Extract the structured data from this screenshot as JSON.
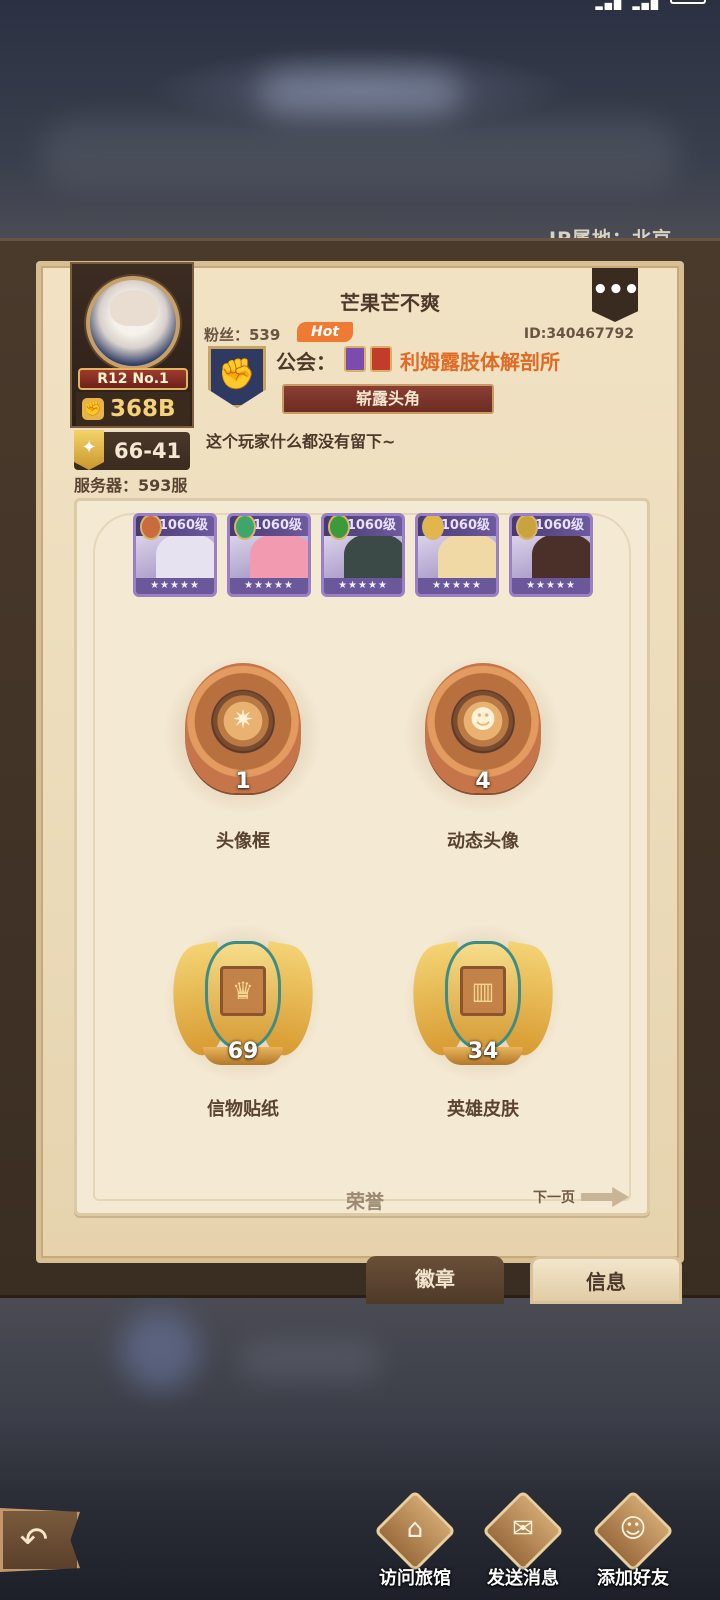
{
  "ip_location": "IP属地：北京",
  "profile": {
    "name": "芒果芒不爽",
    "fans": "粉丝：539",
    "hot_badge": "Hot",
    "id": "ID:340467792",
    "rank": "R12 No.1",
    "power": "368B",
    "score": "66-41",
    "server": "服务器：593服",
    "signature": "这个玩家什么都没有留下~",
    "more_icon": "ellipsis-icon"
  },
  "guild": {
    "label": "公会：",
    "name": "利姆露肢体解剖所",
    "title": "崭露头角",
    "emblem_icon": "fist-emblem-icon"
  },
  "heroes": [
    {
      "level": "1060级",
      "color": "#e7e2ef",
      "faction_color": "#c86b3d"
    },
    {
      "level": "1060级",
      "color": "#f29ab0",
      "faction_color": "#3fa66b"
    },
    {
      "level": "1060级",
      "color": "#3b4a46",
      "faction_color": "#3d9a3a"
    },
    {
      "level": "1060级",
      "color": "#f1d9a6",
      "faction_color": "#e2b64a"
    },
    {
      "level": "1060级",
      "color": "#4a3028",
      "faction_color": "#c9a33e"
    }
  ],
  "hero_stars": "★★★★★",
  "honors": [
    {
      "count": "1",
      "label": "头像框",
      "icon": "compass-star-icon"
    },
    {
      "count": "4",
      "label": "动态头像",
      "icon": "portrait-icon"
    },
    {
      "count": "69",
      "label": "信物贴纸",
      "icon": "crown-sticker-icon"
    },
    {
      "count": "34",
      "label": "英雄皮肤",
      "icon": "wardrobe-icon"
    }
  ],
  "card_title": "荣誉",
  "next_page": "下一页",
  "tabs": {
    "badge": "徽章",
    "info": "信息"
  },
  "actions": [
    {
      "label": "访问旅馆",
      "icon": "tavern-icon"
    },
    {
      "label": "发送消息",
      "icon": "envelope-icon"
    },
    {
      "label": "添加好友",
      "icon": "add-friend-icon"
    }
  ],
  "colors": {
    "accent": "#e06b26",
    "hot": "#ef7a33",
    "frame": "#3a2d22",
    "parchment": "#f1e2c4"
  }
}
